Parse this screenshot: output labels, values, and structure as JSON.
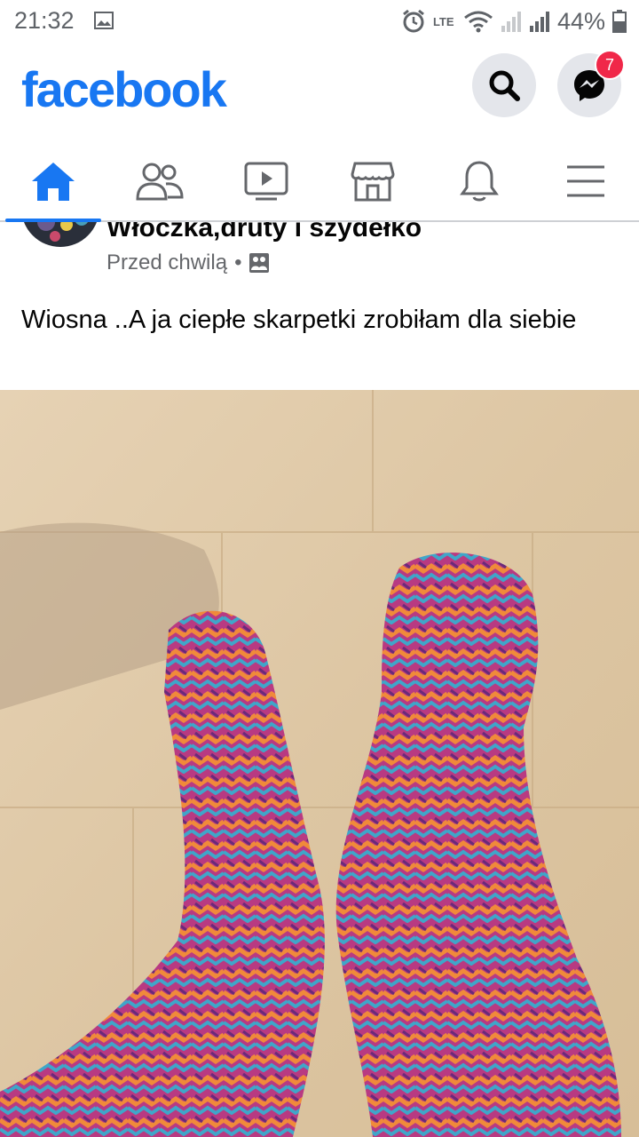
{
  "status_bar": {
    "time": "21:32",
    "battery": "44%",
    "network_label": "LTE"
  },
  "header": {
    "logo": "facebook",
    "messenger_badge": "7",
    "brand_color": "#1877f2"
  },
  "nav": {
    "tabs": [
      {
        "name": "home",
        "icon": "home-icon",
        "active": true
      },
      {
        "name": "friends",
        "icon": "friends-icon",
        "active": false
      },
      {
        "name": "watch",
        "icon": "video-icon",
        "active": false
      },
      {
        "name": "marketplace",
        "icon": "marketplace-icon",
        "active": false
      },
      {
        "name": "notifications",
        "icon": "bell-icon",
        "active": false
      },
      {
        "name": "menu",
        "icon": "hamburger-icon",
        "active": false
      }
    ]
  },
  "post": {
    "author": "Włóczka,druty i szydełko",
    "time": "Przed chwilą",
    "privacy_icon": "group-icon",
    "separator": "•",
    "text": "Wiosna ..A ja ciepłe skarpetki zrobiłam dla siebie",
    "photo_icon": "knitted-socks-photo"
  }
}
